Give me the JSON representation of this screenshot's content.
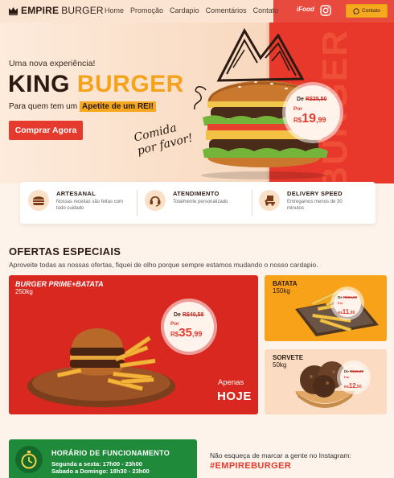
{
  "nav": {
    "brand_main": "EMPIRE",
    "brand_secondary": "BURGER",
    "links": [
      "Home",
      "Promoção",
      "Cardapio",
      "Comentários",
      "Contato"
    ],
    "ifood_label": "iFood",
    "contact_button": "Contato"
  },
  "hero": {
    "subtitle": "Uma nova experiência!",
    "title_part1": "KING",
    "title_part2": "BURGER",
    "tagline": "Para quem tem um",
    "tagline_highlight": "Apetite de um REI!",
    "cta": "Comprar Agora",
    "script_line1": "Comida",
    "script_line2": "por favor!",
    "bg_word": "BURGER",
    "price": {
      "old_label": "De",
      "old_value": "R$25,50",
      "por": "Por",
      "currency": "R$",
      "new_int": "19",
      "new_dec": ",99"
    }
  },
  "features": [
    {
      "title": "ARTESANAL",
      "desc": "Nossas receitas são feitas com todo cuidado",
      "icon": "burger-icon"
    },
    {
      "title": "ATENDIMENTO",
      "desc": "Totalmente personalizado",
      "icon": "headset-icon"
    },
    {
      "title": "DELIVERY SPEED",
      "desc": "Entregamos menos de 30 minutos",
      "icon": "delivery-icon"
    }
  ],
  "offers": {
    "title": "OFERTAS ESPECIAIS",
    "subtitle": "Aproveite todas as nossas ofertas, fiquei de olho porque sempre estamos mudando o nosso cardapio.",
    "main": {
      "name": "BURGER PRIME+BATATA",
      "weight": "250kg",
      "price": {
        "old_label": "De",
        "old_value": "R$40,58",
        "por": "Por",
        "currency": "R$",
        "new_int": "35",
        "new_dec": ",99"
      },
      "apenas": "Apenas",
      "hoje": "HOJE"
    },
    "side1": {
      "name": "BATATA",
      "weight": "150kg",
      "price": {
        "old_label": "De",
        "old_value": "R$15,99",
        "por": "Por",
        "currency": "R$",
        "new_int": "11",
        "new_dec": ",99"
      }
    },
    "side2": {
      "name": "SORVETE",
      "weight": "50kg",
      "price": {
        "old_label": "De",
        "old_value": "R$15,99",
        "por": "Por",
        "currency": "R$",
        "new_int": "12",
        "new_dec": ",50"
      }
    }
  },
  "hours": {
    "title": "HORÁRIO DE FUNCIONAMENTO",
    "line1": "Segunda a sexta: 17h00 - 23h00",
    "line2": "Sabado a Domingo: 18h30 - 23h00"
  },
  "instagram": {
    "text": "Não esqueça de marcar a gente no Instagram:",
    "tag": "#EMPIREBURGER"
  },
  "colors": {
    "primary_red": "#e63a2e",
    "accent_orange": "#f6a81f",
    "dark": "#2b1a12",
    "green": "#1f8a3a"
  }
}
